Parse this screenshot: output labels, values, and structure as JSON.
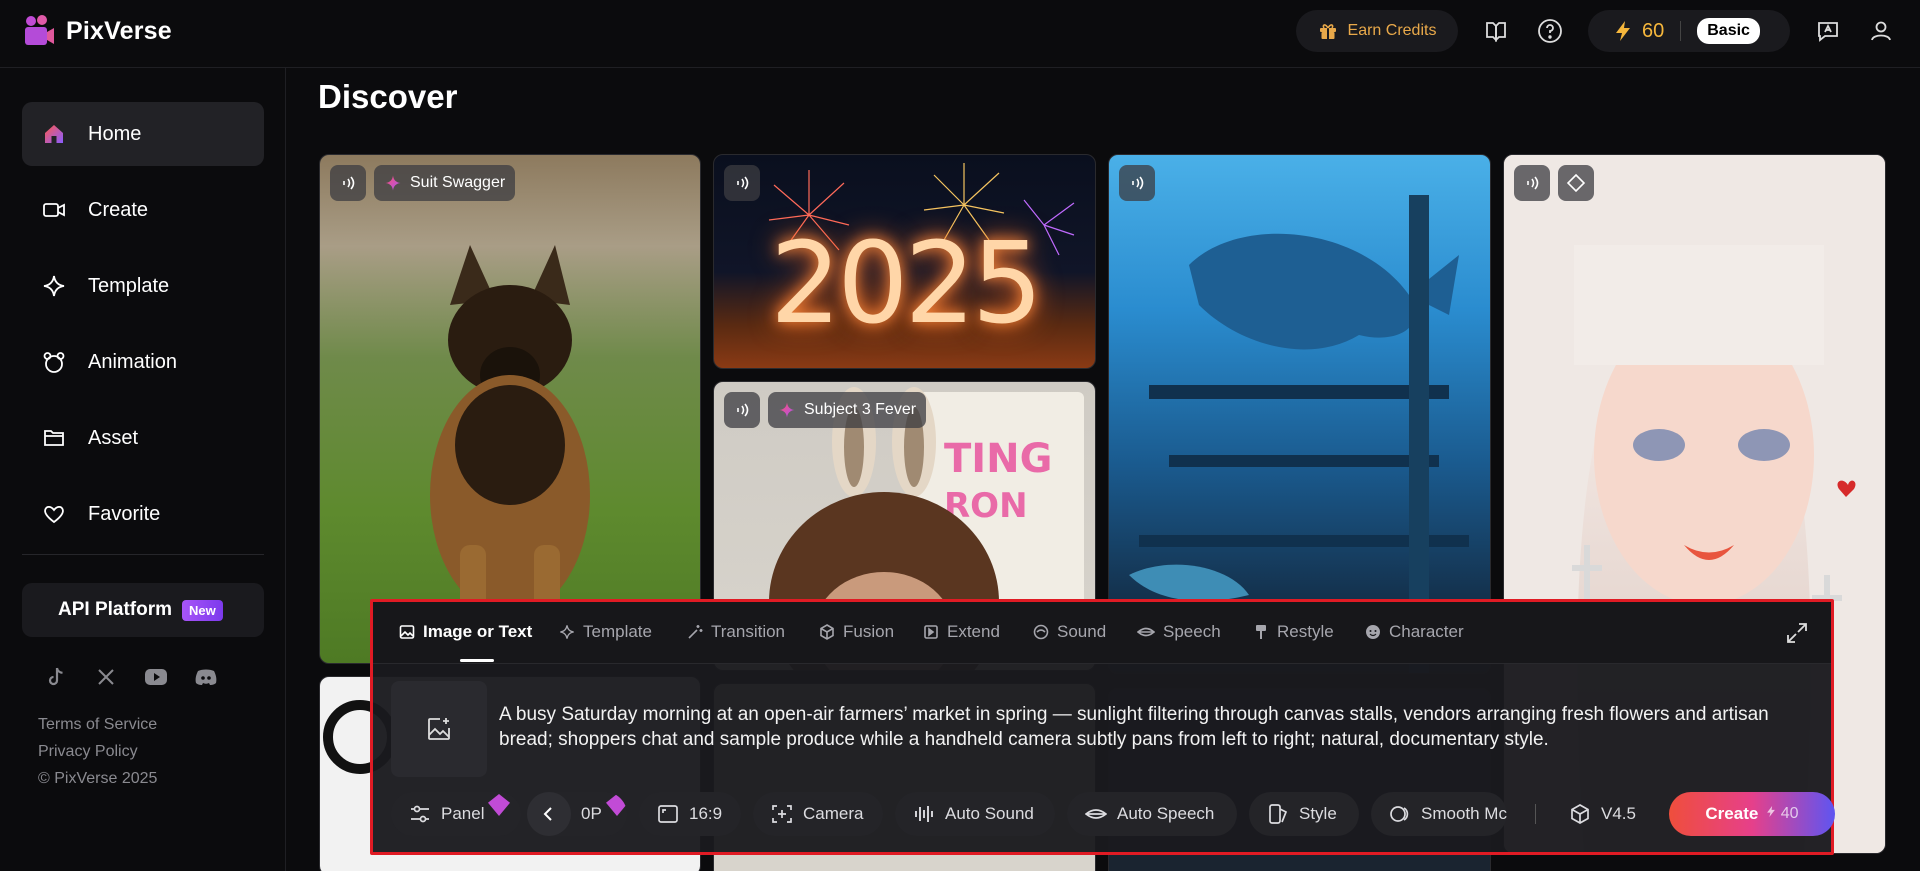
{
  "app": {
    "name": "PixVerse"
  },
  "header": {
    "earn_credits": "Earn Credits",
    "credits": "60",
    "plan": "Basic"
  },
  "sidebar": {
    "items": [
      {
        "label": "Home"
      },
      {
        "label": "Create"
      },
      {
        "label": "Template"
      },
      {
        "label": "Animation"
      },
      {
        "label": "Asset"
      },
      {
        "label": "Favorite"
      }
    ],
    "api_platform": "API Platform",
    "api_badge": "New",
    "footer": {
      "terms": "Terms of Service",
      "privacy": "Privacy Policy",
      "copyright": "© PixVerse 2025"
    }
  },
  "main": {
    "title": "Discover",
    "cards": [
      {
        "tag": "Suit Swagger"
      },
      {
        "text": "2025"
      },
      {
        "tag": "Subject 3 Fever"
      }
    ]
  },
  "panel": {
    "tabs": [
      {
        "label": "Image or Text"
      },
      {
        "label": "Template"
      },
      {
        "label": "Transition"
      },
      {
        "label": "Fusion"
      },
      {
        "label": "Extend"
      },
      {
        "label": "Sound"
      },
      {
        "label": "Speech"
      },
      {
        "label": "Restyle"
      },
      {
        "label": "Character"
      }
    ],
    "prompt": "A busy Saturday morning at an open-air farmers’ market in spring — sunlight filtering through canvas stalls, vendors arranging fresh flowers and artisan bread; shoppers chat and sample produce while a handheld camera subtly pans from left to right; natural, documentary style.",
    "controls": {
      "panel": "Panel",
      "quality": "0P",
      "ratio": "16:9",
      "camera": "Camera",
      "auto_sound": "Auto Sound",
      "auto_speech": "Auto Speech",
      "style": "Style",
      "smooth": "Smooth Mc",
      "model": "V4.5",
      "create": "Create",
      "create_cost": "40"
    }
  },
  "colors": {
    "accent_orange": "#e9a94a",
    "highlight_border": "#e01b24",
    "create_gradient": [
      "#ef4e3c",
      "#e6408a",
      "#5e55f1"
    ]
  }
}
